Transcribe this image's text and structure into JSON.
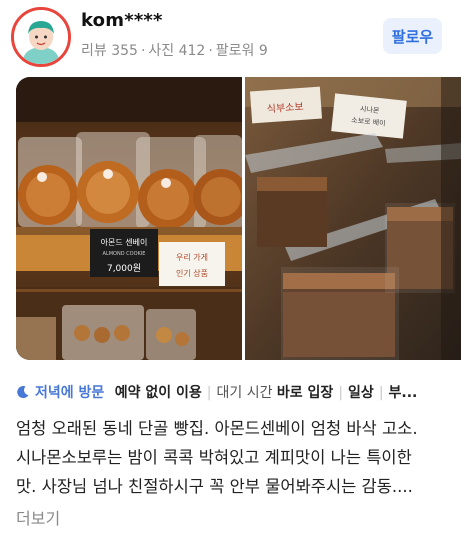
{
  "user": {
    "name": "kom****",
    "stats": {
      "reviews": "리뷰 355",
      "photos": "사진 412",
      "followers": "팔로워 9"
    },
    "follow_label": "팔로우"
  },
  "photos": {
    "photo1": {
      "price_tag_name": "아몬드 센베이",
      "price_tag_sub": "ALMOND COOKIE",
      "price_tag_price": "7,000원",
      "note_line1": "우리 가게",
      "note_line2": "인기 상품"
    },
    "photo2": {
      "sign_left": "식부소보",
      "sign_right_line1": "시나몬",
      "sign_right_line2": "소보로 배이"
    }
  },
  "tags": {
    "visit_time": "저녁에 방문",
    "reservation": "예약 없이 이용",
    "wait_label": "대기 시간",
    "wait_value": "바로 입장",
    "purpose": "일상",
    "more": "부..."
  },
  "review": {
    "line1": "엄청 오래된 동네 단골 빵집. 아몬드센베이 엄청 바삭 고소.",
    "line2": "시나몬소보루는 밤이 콕콕 박혀있고 계피맛이 나는 특이한",
    "line3": "맛. 사장님 넘나 친절하시구 꼭 안부 물어봐주시는 감동....",
    "more_label": "더보기"
  },
  "colors": {
    "accent": "#2f6fe0",
    "avatar_ring": "#e8453c",
    "tag_blue": "#4778d6"
  }
}
